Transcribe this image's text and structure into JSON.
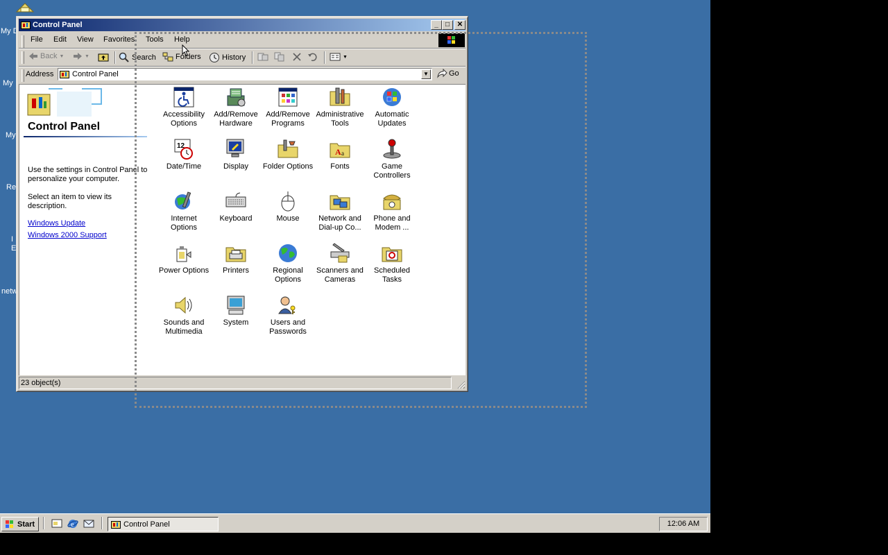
{
  "desktop": {
    "labels": [
      "My D",
      "My",
      "My",
      "Re",
      "I",
      "E",
      "netw"
    ]
  },
  "window": {
    "title": "Control Panel",
    "controls": {
      "minimize": "_",
      "maximize": "□",
      "close": "✕"
    }
  },
  "menu": {
    "items": [
      "File",
      "Edit",
      "View",
      "Favorites",
      "Tools",
      "Help"
    ]
  },
  "toolbar": {
    "back": "Back",
    "search": "Search",
    "folders": "Folders",
    "history": "History"
  },
  "address": {
    "label": "Address",
    "value": "Control Panel",
    "go": "Go"
  },
  "leftpane": {
    "title": "Control Panel",
    "description": "Use the settings in Control Panel to personalize your computer.",
    "hint": "Select an item to view its description.",
    "links": [
      "Windows Update",
      "Windows 2000 Support"
    ]
  },
  "items": [
    {
      "label": "Accessibility Options",
      "icon": "accessibility-icon"
    },
    {
      "label": "Add/Remove Hardware",
      "icon": "hardware-icon"
    },
    {
      "label": "Add/Remove Programs",
      "icon": "programs-icon"
    },
    {
      "label": "Administrative Tools",
      "icon": "admin-tools-icon"
    },
    {
      "label": "Automatic Updates",
      "icon": "windows-update-icon"
    },
    {
      "label": "Date/Time",
      "icon": "clock-icon"
    },
    {
      "label": "Display",
      "icon": "display-icon"
    },
    {
      "label": "Folder Options",
      "icon": "folder-options-icon"
    },
    {
      "label": "Fonts",
      "icon": "fonts-icon"
    },
    {
      "label": "Game Controllers",
      "icon": "joystick-icon"
    },
    {
      "label": "Internet Options",
      "icon": "internet-icon"
    },
    {
      "label": "Keyboard",
      "icon": "keyboard-icon"
    },
    {
      "label": "Mouse",
      "icon": "mouse-icon"
    },
    {
      "label": "Network and Dial-up Co...",
      "icon": "network-icon"
    },
    {
      "label": "Phone and Modem ...",
      "icon": "phone-icon"
    },
    {
      "label": "Power Options",
      "icon": "power-icon"
    },
    {
      "label": "Printers",
      "icon": "printer-icon"
    },
    {
      "label": "Regional Options",
      "icon": "globe-icon"
    },
    {
      "label": "Scanners and Cameras",
      "icon": "scanner-icon"
    },
    {
      "label": "Scheduled Tasks",
      "icon": "tasks-icon"
    },
    {
      "label": "Sounds and Multimedia",
      "icon": "speaker-icon"
    },
    {
      "label": "System",
      "icon": "computer-icon"
    },
    {
      "label": "Users and Passwords",
      "icon": "users-icon"
    }
  ],
  "status": {
    "text": "23 object(s)"
  },
  "taskbar": {
    "start": "Start",
    "task": "Control Panel",
    "clock": "12:06 AM"
  }
}
